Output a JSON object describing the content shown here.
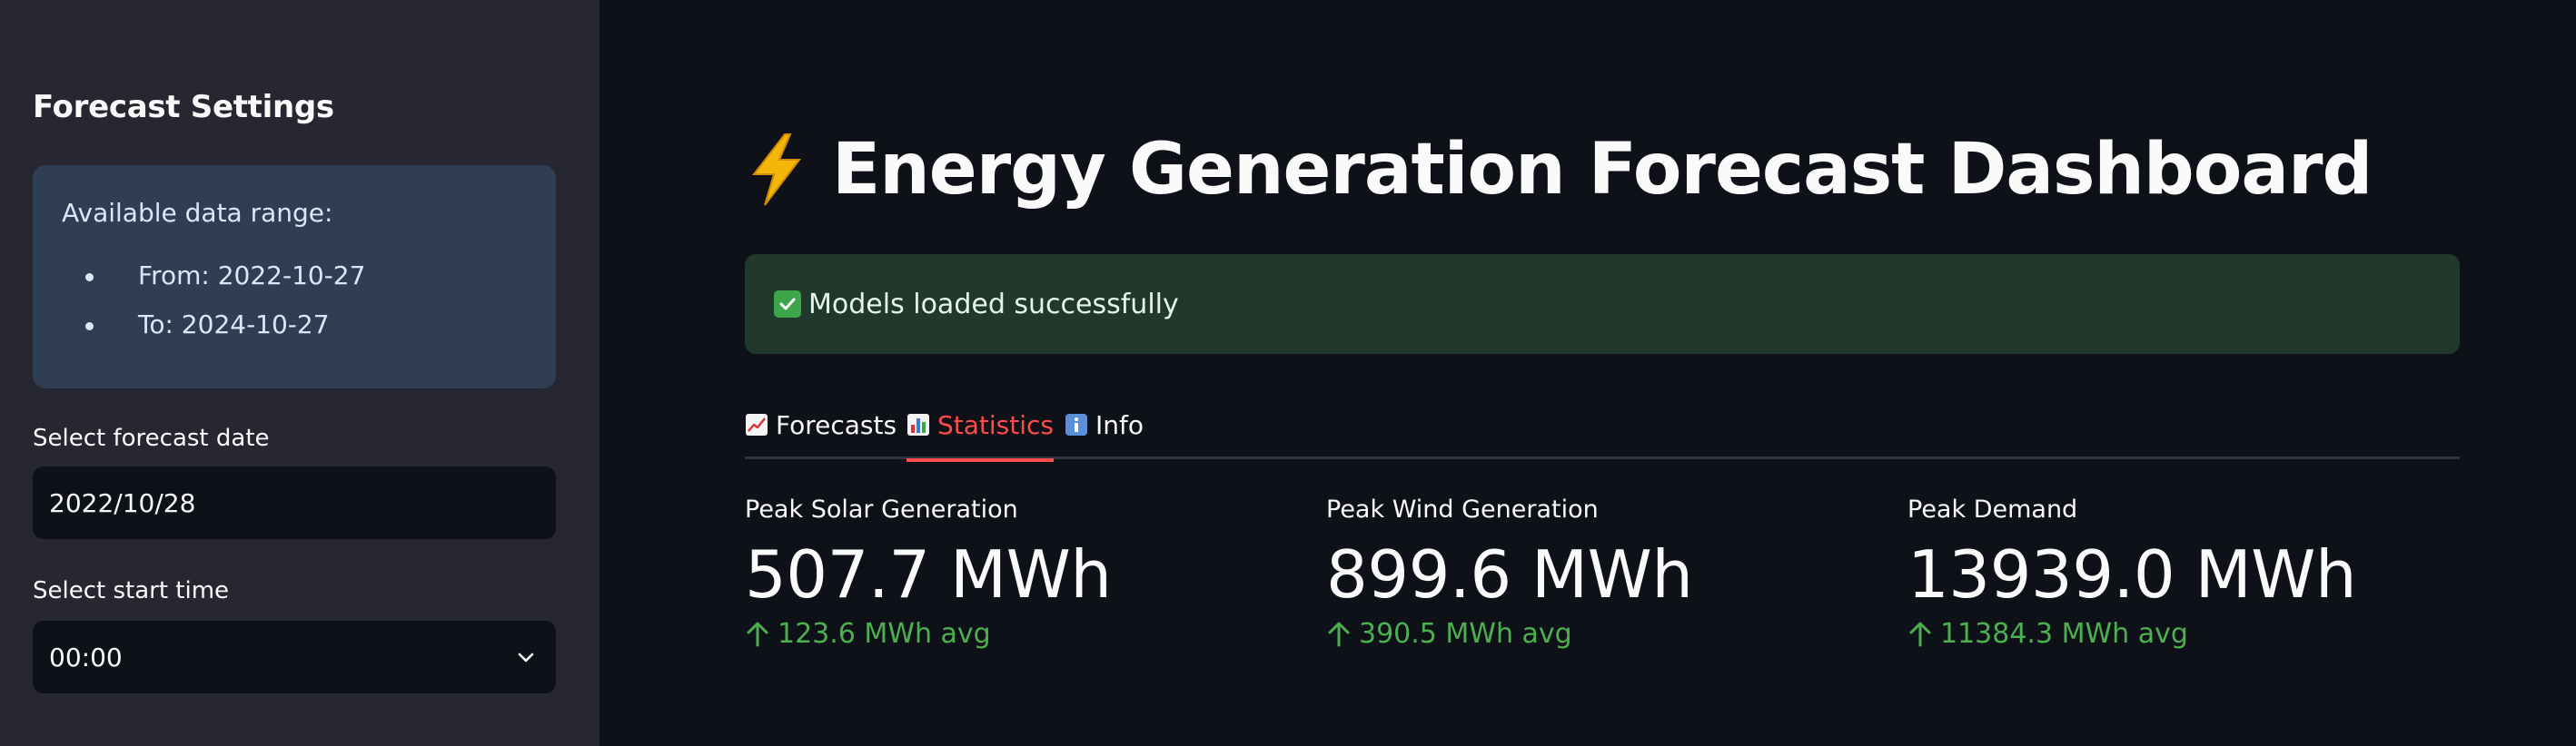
{
  "sidebar": {
    "title": "Forecast Settings",
    "info_box": {
      "heading": "Available data range:",
      "items": [
        "From: 2022-10-27",
        "To: 2024-10-27"
      ]
    },
    "date_field": {
      "label": "Select forecast date",
      "value": "2022/10/28"
    },
    "time_field": {
      "label": "Select start time",
      "value": "00:00",
      "icon": "chevron-down-icon"
    }
  },
  "main": {
    "title_icon": "lightning-bolt-icon",
    "title": "Energy Generation Forecast Dashboard",
    "banner": {
      "icon": "check-icon",
      "text": "Models loaded successfully"
    },
    "tabs": [
      {
        "label": "Forecasts",
        "icon": "chart-increasing-icon",
        "active": false
      },
      {
        "label": "Statistics",
        "icon": "bar-chart-icon",
        "active": true
      },
      {
        "label": "Info",
        "icon": "info-icon",
        "active": false
      }
    ],
    "metrics": [
      {
        "label": "Peak Solar Generation",
        "value": "507.7 MWh",
        "delta": "123.6 MWh avg"
      },
      {
        "label": "Peak Wind Generation",
        "value": "899.6 MWh",
        "delta": "390.5 MWh avg"
      },
      {
        "label": "Peak Demand",
        "value": "13939.0 MWh",
        "delta": "11384.3 MWh avg"
      }
    ]
  },
  "colors": {
    "background": "#0e1117",
    "sidebar": "#262730",
    "info_box": "#2f3e55",
    "success_banner": "#21382c",
    "accent": "#ff4b4b",
    "delta_positive": "#4caf50"
  }
}
